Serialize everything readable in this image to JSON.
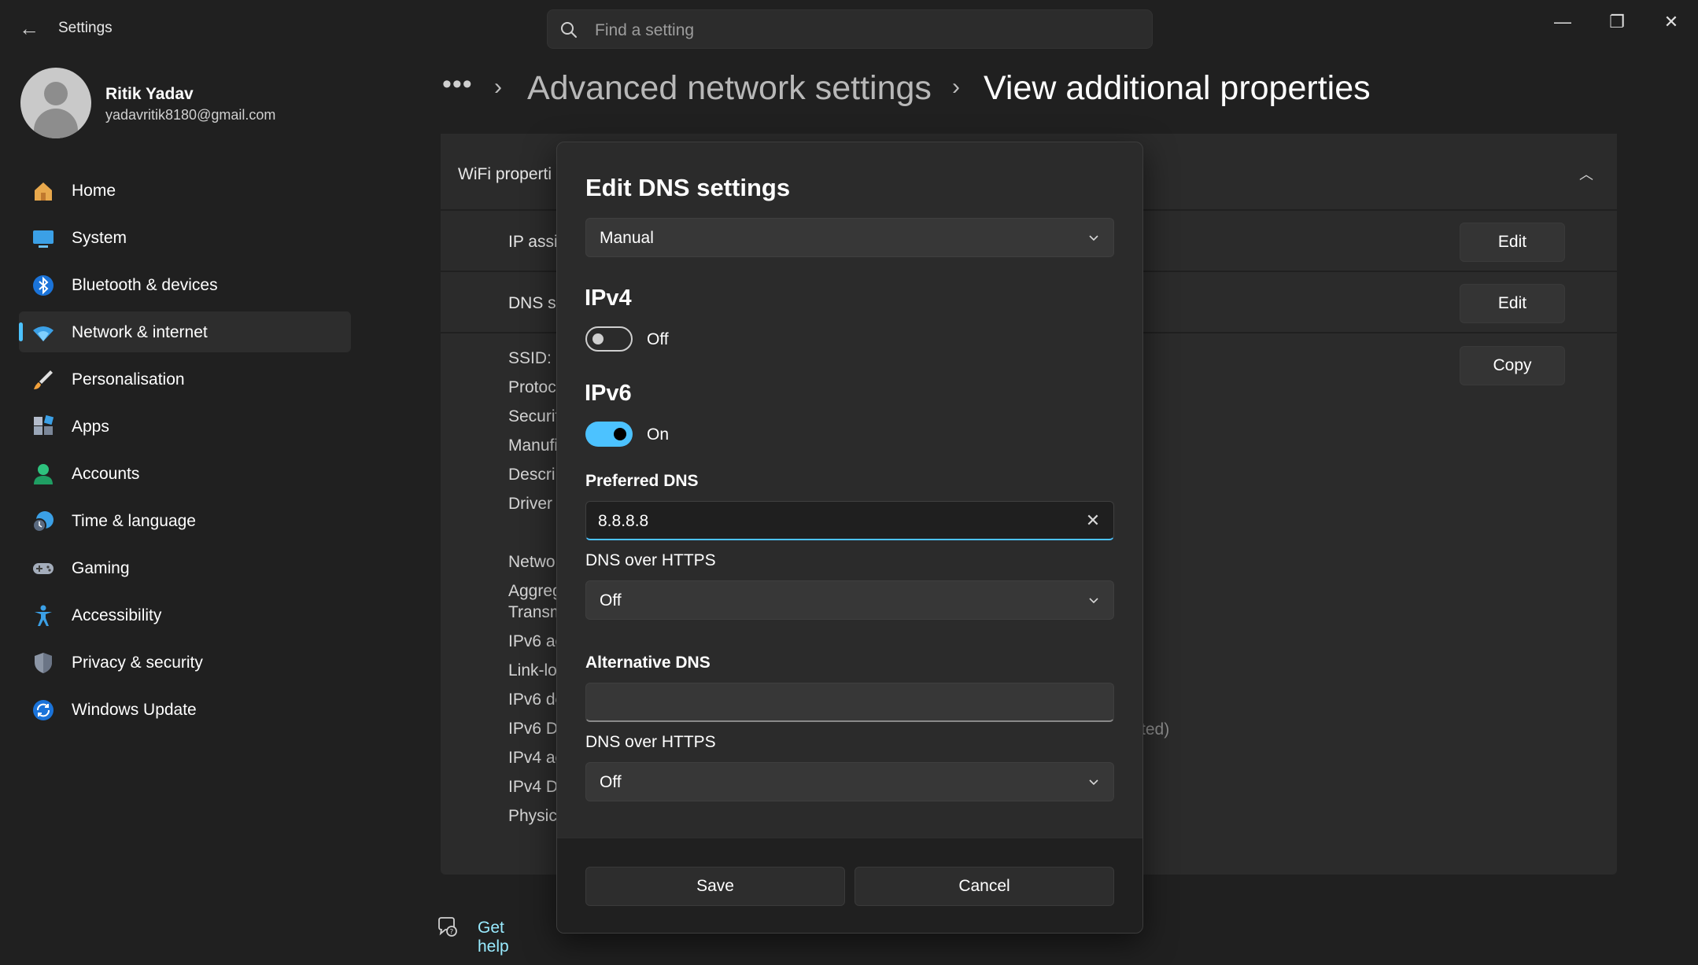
{
  "app": {
    "title": "Settings",
    "search_placeholder": "Find a setting"
  },
  "window_controls": {
    "minimize": "—",
    "maximize": "❐",
    "close": "✕"
  },
  "profile": {
    "name": "Ritik Yadav",
    "email": "yadavritik8180@gmail.com"
  },
  "sidebar": {
    "items": [
      {
        "label": "Home",
        "icon": "home-icon"
      },
      {
        "label": "System",
        "icon": "monitor-icon"
      },
      {
        "label": "Bluetooth & devices",
        "icon": "bluetooth-icon"
      },
      {
        "label": "Network & internet",
        "icon": "wifi-icon",
        "active": true
      },
      {
        "label": "Personalisation",
        "icon": "brush-icon"
      },
      {
        "label": "Apps",
        "icon": "apps-icon"
      },
      {
        "label": "Accounts",
        "icon": "person-icon"
      },
      {
        "label": "Time & language",
        "icon": "globe-clock-icon"
      },
      {
        "label": "Gaming",
        "icon": "gamepad-icon"
      },
      {
        "label": "Accessibility",
        "icon": "accessibility-icon"
      },
      {
        "label": "Privacy & security",
        "icon": "shield-icon"
      },
      {
        "label": "Windows Update",
        "icon": "update-icon"
      }
    ]
  },
  "breadcrumb": {
    "more": "•••",
    "parent": "Advanced network settings",
    "current": "View additional properties"
  },
  "panel": {
    "title": "WiFi properti",
    "rows": [
      {
        "label": "IP assi",
        "action": "Edit"
      },
      {
        "label": "DNS se",
        "action": "Edit"
      },
      {
        "label": "SSID:",
        "action": "Copy"
      }
    ],
    "details": [
      "Protoc",
      "Securit",
      "Manufi",
      "Descri",
      "Driver",
      "Netwo",
      "Aggreg",
      "Transm",
      "IPv6 ac",
      "Link-lo",
      "IPv6 de",
      "IPv6 D",
      "IPv4 ac",
      "IPv4 D",
      "Physica"
    ],
    "faded_text": "ted)"
  },
  "help": {
    "label": "Get help"
  },
  "modal": {
    "title": "Edit DNS settings",
    "mode": "Manual",
    "ipv4": {
      "heading": "IPv4",
      "state": "Off"
    },
    "ipv6": {
      "heading": "IPv6",
      "state": "On"
    },
    "preferred": {
      "label": "Preferred DNS",
      "value": "8.8.8.8"
    },
    "preferred_doh": {
      "label": "DNS over HTTPS",
      "value": "Off"
    },
    "alternate": {
      "label": "Alternative DNS",
      "value": ""
    },
    "alternate_doh": {
      "label": "DNS over HTTPS",
      "value": "Off"
    },
    "save_label": "Save",
    "cancel_label": "Cancel"
  },
  "colors": {
    "accent": "#4cc2ff",
    "background": "#202020",
    "card": "#2b2b2b",
    "link": "#99ebff"
  }
}
